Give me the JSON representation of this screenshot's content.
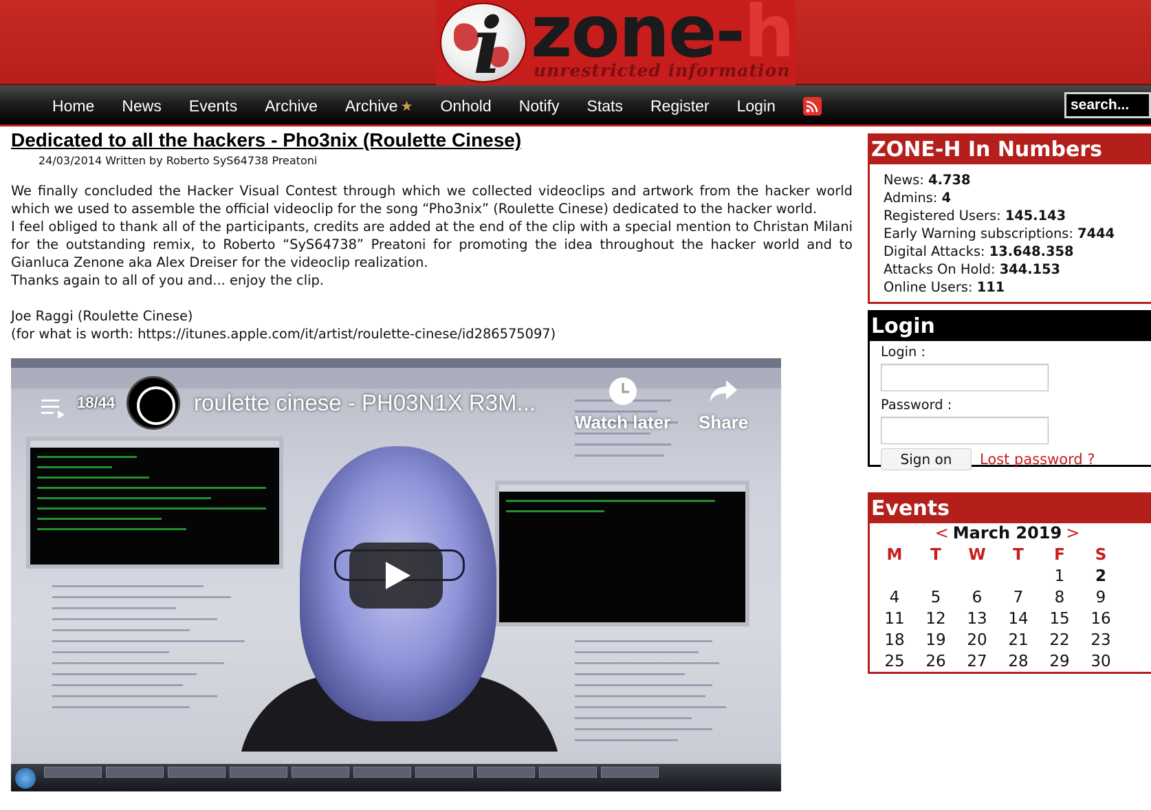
{
  "logo": {
    "brand_main": "zone-",
    "brand_accent": "h",
    "tagline": "unrestricted information",
    "icon_letter": "i"
  },
  "nav": {
    "items": [
      "Home",
      "News",
      "Events",
      "Archive",
      "Archive",
      "Onhold",
      "Notify",
      "Stats",
      "Register",
      "Login"
    ],
    "archive_star_icon": "star-icon",
    "rss_icon": "rss-icon",
    "search_placeholder": "search..."
  },
  "article": {
    "title": "Dedicated to all the hackers - Pho3nix (Roulette Cinese)",
    "meta": "24/03/2014 Written by Roberto SyS64738 Preatoni",
    "paragraphs": [
      "We finally concluded the Hacker Visual Contest through which we collected videoclips and artwork from the hacker world which we used to assemble the official videoclip for the song “Pho3nix” (Roulette Cinese) dedicated to the hacker world.",
      "I feel obliged to thank all of the participants, credits are added at the end of the clip with a special mention to Christan Milani for the outstanding remix, to Roberto “SyS64738” Preatoni for promoting the idea throughout the hacker world and to Gianluca Zenone aka Alex Dreiser for the videoclip realization.",
      "Thanks again to all of you and... enjoy the clip."
    ],
    "signature": "Joe Raggi (Roulette Cinese)",
    "link_line": "(for what is worth: https://itunes.apple.com/it/artist/roulette-cinese/id286575097)"
  },
  "video": {
    "playlist_count": "18/44",
    "title": "roulette cinese - PH03N1X R3M...",
    "watch_later": "Watch later",
    "share": "Share"
  },
  "numbers": {
    "title": "ZONE-H In Numbers",
    "rows": [
      {
        "label": "News:",
        "value": "4.738"
      },
      {
        "label": "Admins:",
        "value": "4"
      },
      {
        "label": "Registered Users:",
        "value": "145.143"
      },
      {
        "label": "Early Warning subscriptions:",
        "value": "7444"
      },
      {
        "label": "Digital Attacks:",
        "value": "13.648.358"
      },
      {
        "label": "Attacks On Hold:",
        "value": "344.153"
      },
      {
        "label": "Online Users:",
        "value": "111"
      }
    ]
  },
  "login": {
    "title": "Login",
    "login_label": "Login :",
    "password_label": "Password :",
    "sign_on": "Sign on",
    "lost_password": "Lost password ?"
  },
  "events": {
    "title": "Events",
    "prev": "<",
    "month": "March 2019",
    "next": ">",
    "weekdays": [
      "M",
      "T",
      "W",
      "T",
      "F",
      "S"
    ],
    "weeks": [
      [
        "",
        "",
        "",
        "",
        "1",
        "2"
      ],
      [
        "4",
        "5",
        "6",
        "7",
        "8",
        "9"
      ],
      [
        "11",
        "12",
        "13",
        "14",
        "15",
        "16"
      ],
      [
        "18",
        "19",
        "20",
        "21",
        "22",
        "23"
      ],
      [
        "25",
        "26",
        "27",
        "28",
        "29",
        "30"
      ]
    ],
    "highlighted_day": "2"
  },
  "colors": {
    "brand_red": "#b51f1b",
    "nav_black": "#000000",
    "link_red": "#c81d1d"
  }
}
